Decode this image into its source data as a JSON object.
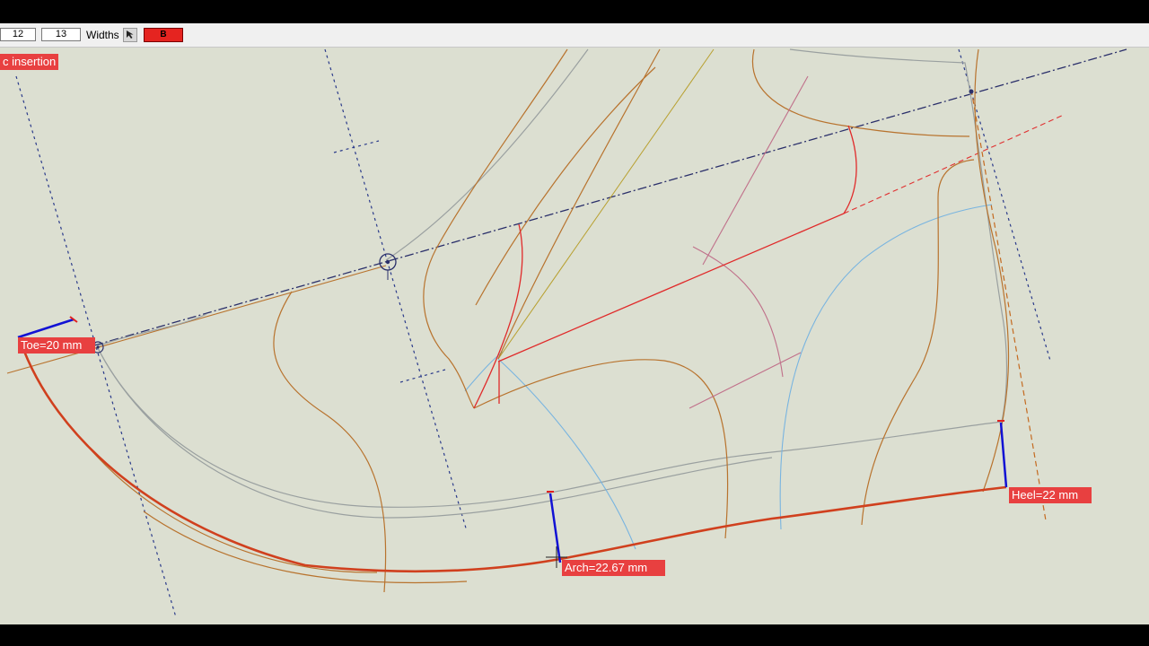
{
  "toolbar": {
    "field_a": "12",
    "field_b": "13",
    "widths_label": "Widths",
    "b_button_label": "B"
  },
  "canvas": {
    "mode_label": "c insertion",
    "measurements": {
      "toe": "Toe=20 mm",
      "arch": "Arch=22.67 mm",
      "heel": "Heel=22 mm"
    }
  },
  "colors": {
    "background": "#dcdfd1",
    "sole_line": "#d0401e",
    "pattern_lines": "#b8732e",
    "guide_dashed": "#2a2f7a",
    "measurement_bar": "#1010d0",
    "label_bg": "#e84040"
  }
}
